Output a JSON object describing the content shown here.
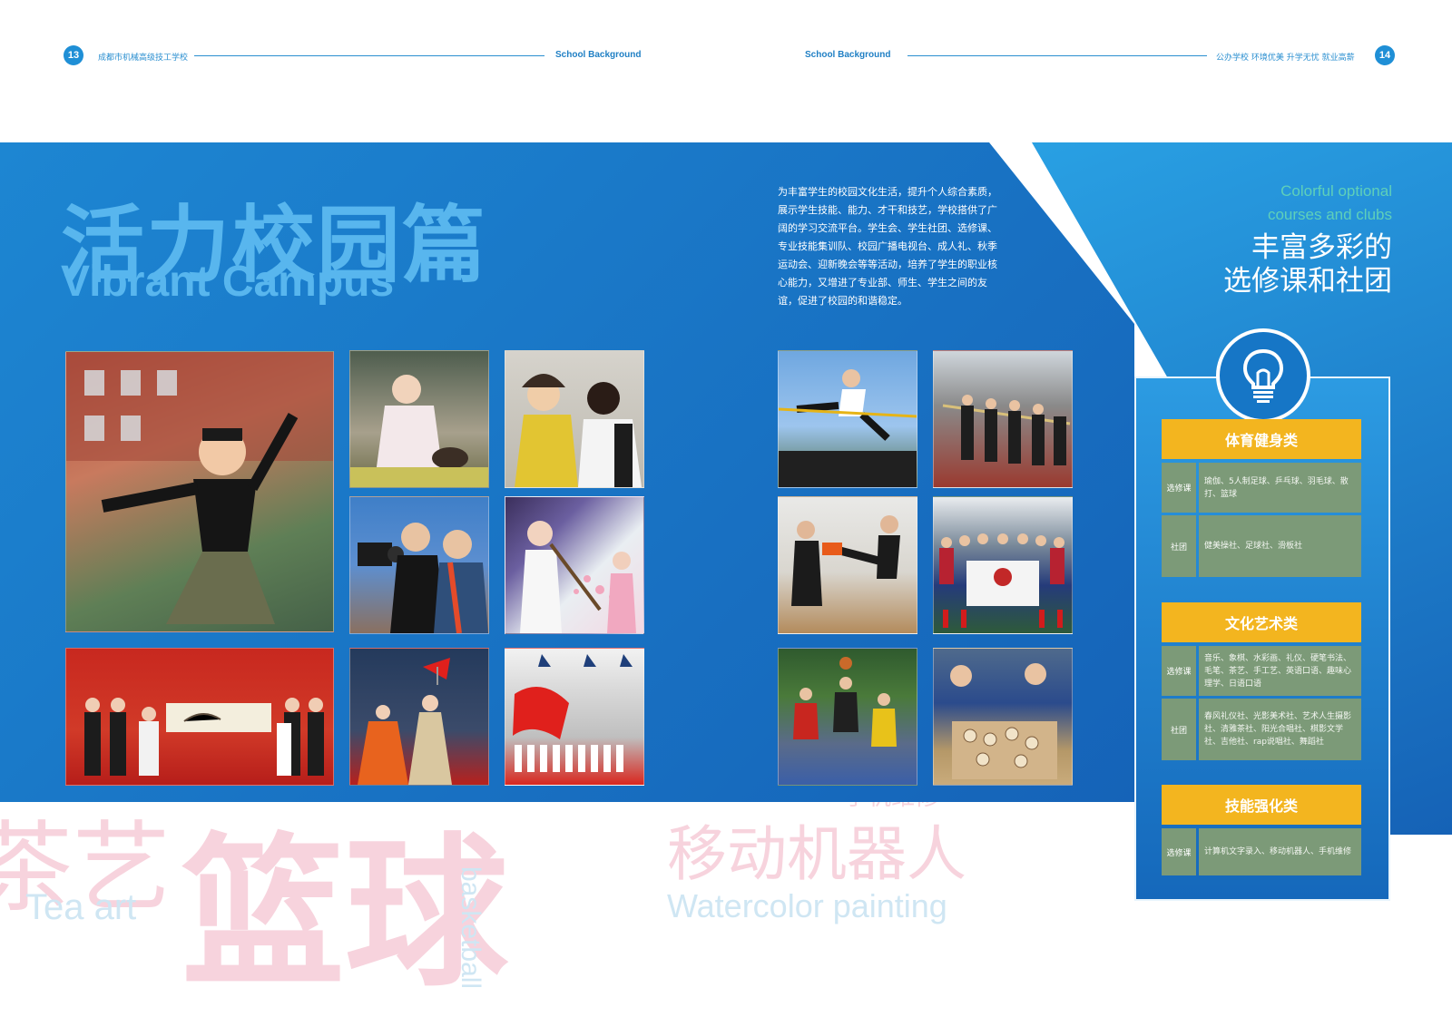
{
  "header": {
    "left_page_number": "13",
    "left_school": "成都市机械高级技工学校",
    "left_section": "School Background",
    "right_section": "School Background",
    "right_slogan": "公办学校 环境优美 升学无忧 就业高薪",
    "right_page_number": "14"
  },
  "title": {
    "chinese": "活力校园篇",
    "english": "Vibrant Campus"
  },
  "intro_text": "为丰富学生的校园文化生活，提升个人综合素质，展示学生技能、能力、才干和技艺，学校搭供了广阔的学习交流平台。学生会、学生社团、选修课、专业技能集训队、校园广播电视台、成人礼、秋季运动会、迎新晚会等等活动，培养了学生的职业核心能力，又增进了专业部、师生、学生之间的友谊，促进了校园的和谐稳定。",
  "right_title": {
    "english_line1": "Colorful optional",
    "english_line2": "courses and clubs",
    "chinese_line1": "丰富多彩的",
    "chinese_line2": "选修课和社团"
  },
  "categories": [
    {
      "name": "体育健身类",
      "rows": [
        {
          "label": "选修课",
          "text": "瑜伽、5人制足球、乒乓球、羽毛球、散打、篮球"
        },
        {
          "label": "社团",
          "text": "健美操社、足球社、滑板社"
        }
      ]
    },
    {
      "name": "文化艺术类",
      "rows": [
        {
          "label": "选修课",
          "text": "音乐、象棋、水彩画、礼仪、硬笔书法、毛笔、茶艺、手工艺、英语口语、趣味心理学、日语口语"
        },
        {
          "label": "社团",
          "text": "春风礼仪社、光影美术社、艺术人生摄影社、清雅茶社、阳光合唱社、棋影文学社、吉他社、rap说唱社、舞蹈社"
        }
      ]
    },
    {
      "name": "技能强化类",
      "rows": [
        {
          "label": "选修课",
          "text": "计算机文字录入、移动机器人、手机维修"
        }
      ]
    }
  ],
  "watermark": {
    "teaart_cn": "茶艺",
    "basketball_cn": "篮球",
    "robot_cn": "移动机器人",
    "teaart_en": "Tea art",
    "watercolor_en": "Watercolor painting",
    "basketball_en": "basketball",
    "phone_repair_cn": "手机维修"
  },
  "photos": [
    {
      "name": "dance-photo",
      "icon": "dancer"
    },
    {
      "name": "tea-ceremony-photo",
      "icon": "teapot"
    },
    {
      "name": "makeup-photo",
      "icon": "person"
    },
    {
      "name": "camera-club-photo",
      "icon": "camera"
    },
    {
      "name": "flute-performance-photo",
      "icon": "flute"
    },
    {
      "name": "calligraphy-ceremony-photo",
      "icon": "scroll"
    },
    {
      "name": "stage-singing-photo",
      "icon": "flag"
    },
    {
      "name": "parade-flag-photo",
      "icon": "flag"
    },
    {
      "name": "high-jump-photo",
      "icon": "runner"
    },
    {
      "name": "tug-of-war-photo",
      "icon": "rope"
    },
    {
      "name": "martial-arts-photo",
      "icon": "kick"
    },
    {
      "name": "football-team-photo",
      "icon": "banner"
    },
    {
      "name": "basketball-game-photo",
      "icon": "ball"
    },
    {
      "name": "chinese-chess-photo",
      "icon": "chess"
    }
  ],
  "colors": {
    "primary_blue": "#1d86d2",
    "light_blue_title": "#58b6ee",
    "category_yellow": "#f3b51f",
    "row_green": "#7c9a78",
    "watermark_pink": "#f7d3dd",
    "english_accent": "#5fd0b9"
  }
}
